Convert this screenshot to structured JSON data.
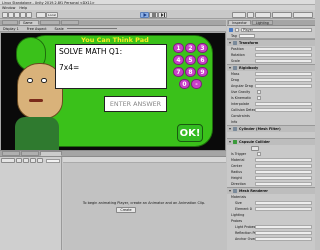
{
  "window": {
    "title": "Linux Standalone - Unity 2019.2.8f1 Personal <DX11>"
  },
  "menubar": {
    "items": [
      "Window",
      "Help"
    ]
  },
  "toolbar": {
    "local_label": "Local",
    "play_icon": "play-icon",
    "pause_icon": "pause-icon",
    "step_icon": "step-icon"
  },
  "scene_tabs": {
    "game_tab": "Game",
    "display": "Display 1",
    "aspect": "Free Aspect",
    "scale_label": "Scale"
  },
  "game": {
    "title": "You Can Think Pad",
    "question": "SOLVE MATH Q1:",
    "equation": "7x4=",
    "answer_placeholder": "ENTER ANSWER",
    "ok_label": "OK!",
    "keys": [
      "1",
      "2",
      "3",
      "4",
      "5",
      "6",
      "7",
      "8",
      "9",
      "0",
      "-"
    ]
  },
  "inspector": {
    "tabs": [
      "Inspector",
      "Lighting"
    ],
    "object_name": "Player",
    "tag_label": "Tag",
    "sections": {
      "transform": {
        "title": "Transform",
        "rows": [
          "Position",
          "Rotation",
          "Scale"
        ]
      },
      "rigidbody": {
        "title": "Rigidbody",
        "rows": [
          "Mass",
          "Drag",
          "Angular Drag",
          "Use Gravity",
          "Is Kinematic",
          "Interpolate",
          "Collision Detection",
          "Constraints",
          "Info"
        ]
      },
      "mesh_filter": {
        "title": "Cylinder (Mesh Filter)"
      },
      "capsule": {
        "title": "Capsule Collider",
        "rows": [
          "Is Trigger",
          "Material",
          "Center",
          "Radius",
          "Height",
          "Direction"
        ]
      },
      "renderer": {
        "title": "Mesh Renderer",
        "rows": [
          "Materials",
          "Size",
          "Element 0",
          "Lighting",
          "Probes",
          "Light Probes",
          "Reflection Probes",
          "Anchor Override"
        ]
      }
    }
  },
  "animation_panel": {
    "message": "To begin animating Player, create an Animator and an Animation Clip.",
    "create_label": "Create"
  },
  "colors": {
    "pad_green": "#3ac11a",
    "pad_purple": "#c940c9",
    "ok_green": "#33bb22"
  }
}
